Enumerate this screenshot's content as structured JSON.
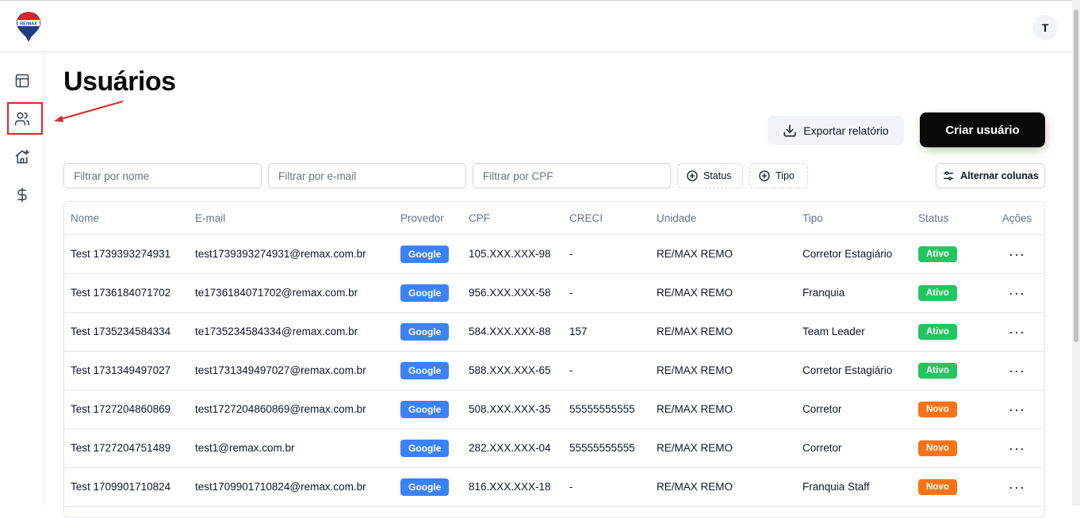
{
  "header": {
    "logo_text": "RE/MAX",
    "avatar_initial": "T"
  },
  "sidebar": {
    "items": [
      {
        "icon": "layout-icon",
        "active": false
      },
      {
        "icon": "users-icon",
        "active": true
      },
      {
        "icon": "house-plus-icon",
        "active": false
      },
      {
        "icon": "dollar-icon",
        "active": false
      }
    ]
  },
  "page": {
    "title": "Usuários",
    "export_label": "Exportar relatório",
    "create_label": "Criar usuário"
  },
  "filters": {
    "name_placeholder": "Filtrar por nome",
    "email_placeholder": "Filtrar por e-mail",
    "cpf_placeholder": "Filtrar por CPF",
    "status_label": "Status",
    "type_label": "Tipo",
    "columns_label": "Alternar colunas"
  },
  "table": {
    "headers": {
      "name": "Nome",
      "email": "E-mail",
      "provider": "Provedor",
      "cpf": "CPF",
      "creci": "CRECI",
      "unit": "Unidade",
      "type": "Tipo",
      "status": "Status",
      "actions": "Ações"
    },
    "rows": [
      {
        "name": "Test 1739393274931",
        "email": "test1739393274931@remax.com.br",
        "provider": "Google",
        "cpf": "105.XXX.XXX-98",
        "creci": "-",
        "unit": "RE/MAX REMO",
        "type": "Corretor Estagiário",
        "status": "Ativo"
      },
      {
        "name": "Test 1736184071702",
        "email": "te1736184071702@remax.com.br",
        "provider": "Google",
        "cpf": "956.XXX.XXX-58",
        "creci": "-",
        "unit": "RE/MAX REMO",
        "type": "Franquia",
        "status": "Ativo"
      },
      {
        "name": "Test 1735234584334",
        "email": "te1735234584334@remax.com.br",
        "provider": "Google",
        "cpf": "584.XXX.XXX-88",
        "creci": "157",
        "unit": "RE/MAX REMO",
        "type": "Team Leader",
        "status": "Ativo"
      },
      {
        "name": "Test 1731349497027",
        "email": "test1731349497027@remax.com.br",
        "provider": "Google",
        "cpf": "588.XXX.XXX-65",
        "creci": "-",
        "unit": "RE/MAX REMO",
        "type": "Corretor Estagiário",
        "status": "Ativo"
      },
      {
        "name": "Test 1727204860869",
        "email": "test1727204860869@remax.com.br",
        "provider": "Google",
        "cpf": "508.XXX.XXX-35",
        "creci": "55555555555",
        "unit": "RE/MAX REMO",
        "type": "Corretor",
        "status": "Novo"
      },
      {
        "name": "Test 1727204751489",
        "email": "test1@remax.com.br",
        "provider": "Google",
        "cpf": "282.XXX.XXX-04",
        "creci": "55555555555",
        "unit": "RE/MAX REMO",
        "type": "Corretor",
        "status": "Novo"
      },
      {
        "name": "Test 1709901710824",
        "email": "test1709901710824@remax.com.br",
        "provider": "Google",
        "cpf": "816.XXX.XXX-18",
        "creci": "-",
        "unit": "RE/MAX REMO",
        "type": "Franquia Staff",
        "status": "Novo"
      }
    ]
  },
  "colors": {
    "google_badge": "#3b82f6",
    "status_ativo": "#22c55e",
    "status_novo": "#f97316",
    "annotation_red": "#dc2626"
  }
}
